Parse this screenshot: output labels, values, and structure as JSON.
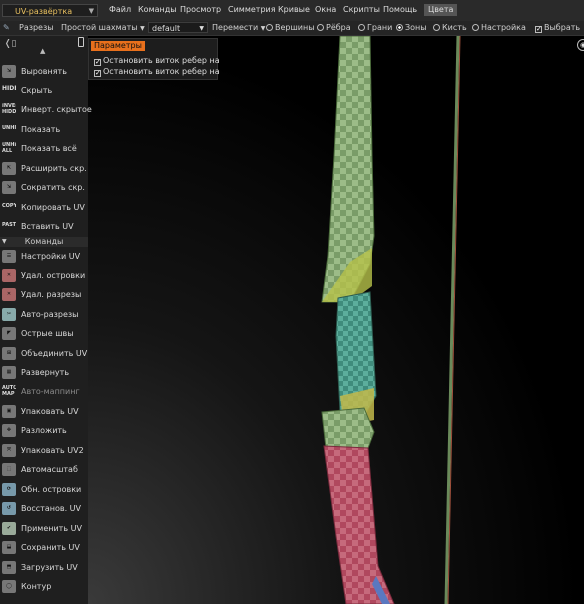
{
  "menubar": {
    "mode": "UV-развёртка",
    "items": [
      "Файл",
      "Команды",
      "Просмотр",
      "Симметрия",
      "Кривые",
      "Окна",
      "Скрипты",
      "Помощь",
      "Цвета"
    ],
    "active_item": "Цвета"
  },
  "toolbar": {
    "cuts": "Разрезы",
    "checker": "Простой шахматы",
    "preset": "default",
    "move": "Перемести",
    "radio_options": [
      "Вершины",
      "Рёбра",
      "Грани",
      "Зоны",
      "Кисть",
      "Настройка"
    ],
    "selected_radio": "Зоны",
    "select_checkbox": "Выбрать"
  },
  "params_panel": {
    "title": "Параметры",
    "options": [
      "Остановить виток ребер на",
      "Остановить виток ребер на"
    ]
  },
  "sidebar": {
    "tools_top": [
      {
        "label": "Выровнять",
        "icon": "align-icon",
        "icon_text": ""
      },
      {
        "label": "Скрыть",
        "icon": "hide-icon",
        "icon_text": "HIDE"
      },
      {
        "label": "Инверт. скрытое",
        "icon": "invert-hidden-icon",
        "icon_text": "INVERT HIDDEN"
      },
      {
        "label": "Показать",
        "icon": "unhide-icon",
        "icon_text": "UNHIDE"
      },
      {
        "label": "Показать всё",
        "icon": "unhide-all-icon",
        "icon_text": "UNHIDE ALL"
      },
      {
        "label": "Расширить скр.",
        "icon": "expand-icon",
        "icon_text": ""
      },
      {
        "label": "Сократить скр.",
        "icon": "shrink-icon",
        "icon_text": ""
      },
      {
        "label": "Копировать UV",
        "icon": "copy-icon",
        "icon_text": "COPY"
      },
      {
        "label": "Вставить UV",
        "icon": "paste-icon",
        "icon_text": "PASTE"
      }
    ],
    "commands_header": "Команды",
    "commands": [
      {
        "label": "Настройки UV",
        "icon": "uv-settings-icon"
      },
      {
        "label": "Удал. островки",
        "icon": "delete-islands-icon"
      },
      {
        "label": "Удал. разрезы",
        "icon": "delete-cuts-icon"
      },
      {
        "label": "Авто-разрезы",
        "icon": "auto-cuts-icon"
      },
      {
        "label": "Острые швы",
        "icon": "sharp-seams-icon"
      },
      {
        "label": "Объединить UV",
        "icon": "merge-uv-icon"
      },
      {
        "label": "Развернуть",
        "icon": "unwrap-icon"
      },
      {
        "label": "Авто-маппинг",
        "icon": "auto-map-icon",
        "dim": true
      },
      {
        "label": "Упаковать UV",
        "icon": "pack-uv-icon"
      },
      {
        "label": "Разложить",
        "icon": "layout-icon"
      },
      {
        "label": "Упаковать UV2",
        "icon": "pack-uv2-icon"
      },
      {
        "label": "Автомасштаб",
        "icon": "auto-scale-icon"
      },
      {
        "label": "Обн. островки",
        "icon": "update-islands-icon"
      },
      {
        "label": "Восстанов. UV",
        "icon": "restore-uv-icon"
      },
      {
        "label": "Применить UV",
        "icon": "apply-uv-icon"
      },
      {
        "label": "Сохранить UV",
        "icon": "save-uv-icon"
      },
      {
        "label": "Загрузить UV",
        "icon": "load-uv-icon"
      },
      {
        "label": "Контур",
        "icon": "contour-icon"
      }
    ]
  },
  "colors": {
    "accent": "#e8701c",
    "mode_text": "#e8c060",
    "checker_green": "#7ca06a",
    "grip_teal": "#4c9c8c",
    "limb_pink": "#c0506a"
  }
}
